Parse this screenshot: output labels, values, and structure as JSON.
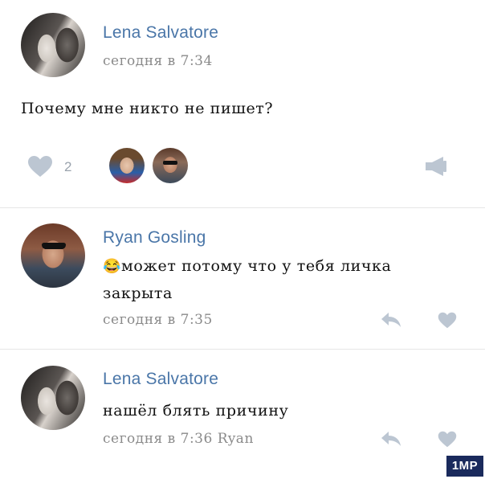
{
  "post": {
    "author": "Lena Salvatore",
    "time": "сегодня в 7:34",
    "text": "Почему мне никто не пишет?",
    "likes": "2"
  },
  "comments": [
    {
      "author": "Ryan Gosling",
      "emoji": "😂",
      "text_line1": "может потому что у тебя личка",
      "text_line2": "закрыта",
      "time": "сегодня в 7:35"
    },
    {
      "author": "Lena Salvatore",
      "text": "нашёл блять причину",
      "time": "сегодня в 7:36 Ryan"
    }
  ],
  "watermark": "1MP",
  "colors": {
    "accent": "#4a76a8",
    "icon": "#bcc6d2",
    "muted": "#8a8a8a"
  },
  "icons": [
    "heart-icon",
    "share-icon",
    "reply-icon",
    "like-icon"
  ]
}
